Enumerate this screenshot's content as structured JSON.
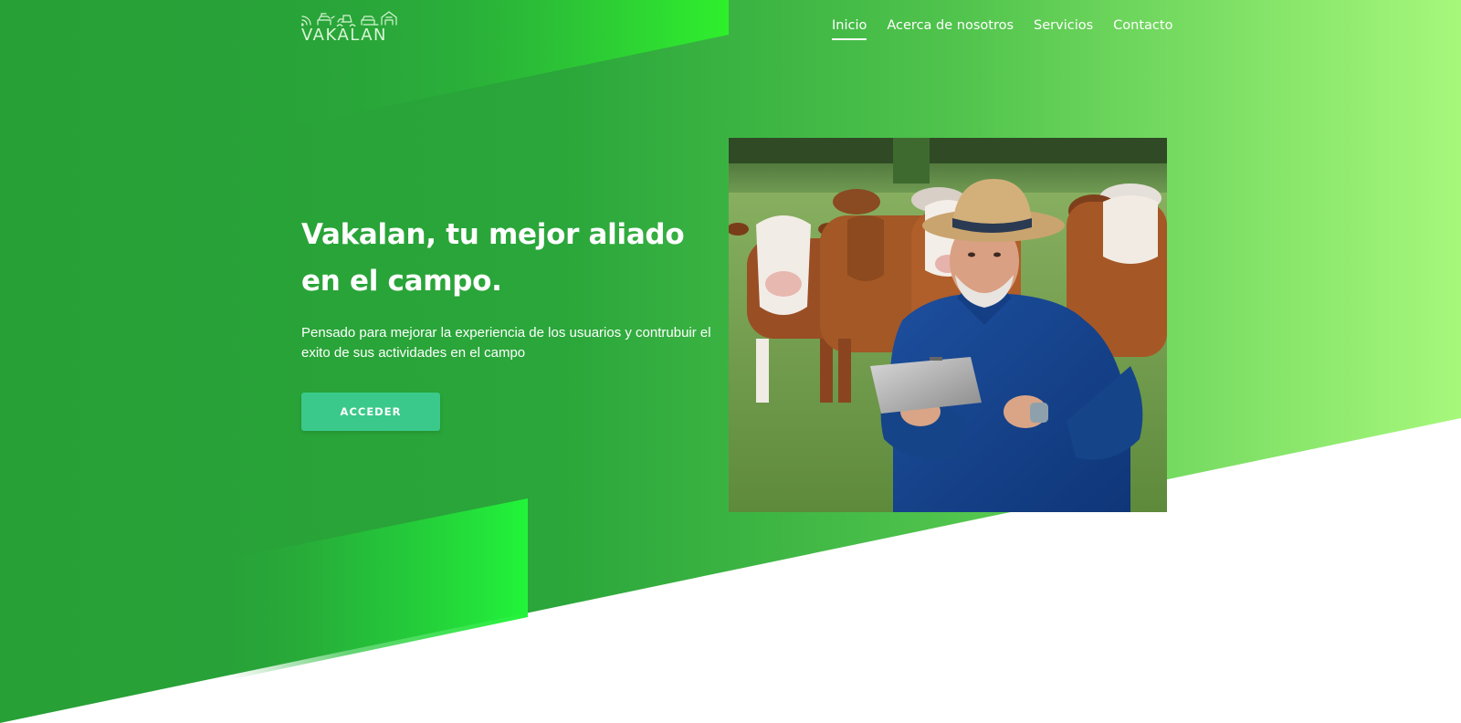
{
  "brand": {
    "name": "VAKALAN",
    "logo_icon": "farm-tractor-cattle-icon",
    "logo_color": "#d9f5d6"
  },
  "nav": {
    "items": [
      {
        "label": "Inicio",
        "active": true
      },
      {
        "label": "Acerca de nosotros",
        "active": false
      },
      {
        "label": "Servicios",
        "active": false
      },
      {
        "label": "Contacto",
        "active": false
      }
    ]
  },
  "hero": {
    "title": "Vakalan, tu mejor aliado en el campo.",
    "subtitle": "Pensado para mejorar la experiencia de los usuarios y contrubuir el exito de sus actividades en el campo",
    "cta_label": "ACCEDER",
    "image_subject": "farmer-with-tablet-and-cattle"
  },
  "colors": {
    "primary_green": "#2aa338",
    "light_green": "#a4f57c",
    "accent_green": "#22f03a",
    "button": "#3ac98a",
    "text": "#ffffff"
  }
}
